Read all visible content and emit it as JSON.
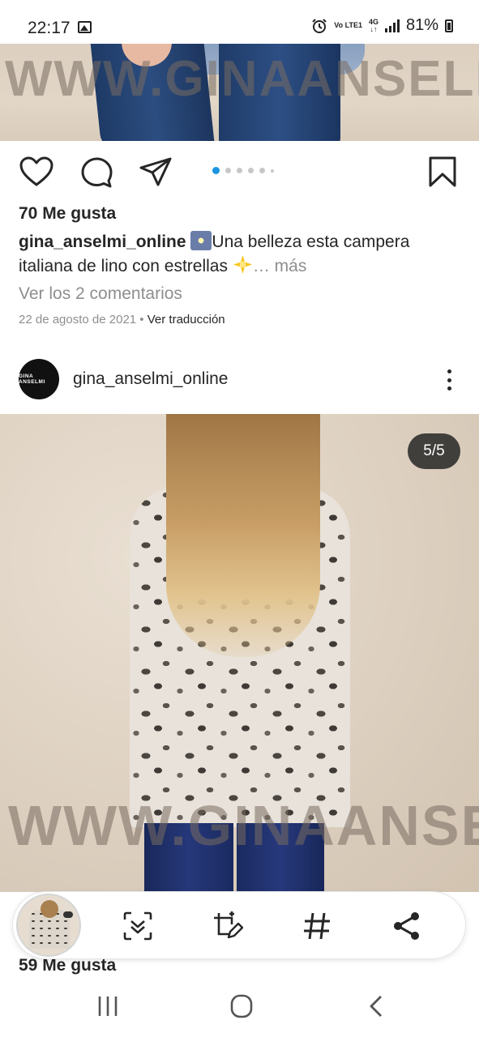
{
  "status_bar": {
    "time": "22:17",
    "volte": "Vo LTE1",
    "network": "4G",
    "battery": "81%"
  },
  "post1": {
    "watermark": "WWW.GINAANSELMI.COM",
    "likes": "70 Me gusta",
    "username": "gina_anselmi_online",
    "caption_line1": "Una belleza esta campera",
    "caption_line2": "italiana de lino con estrellas",
    "more": "… más",
    "view_comments": "Ver los 2 comentarios",
    "date": "22 de agosto de 2021",
    "separator": " • ",
    "translate": "Ver traducción",
    "carousel_total_dots": 6,
    "carousel_active_index": 0
  },
  "post2": {
    "avatar_text": "GINA ANSELMI",
    "username": "gina_anselmi_online",
    "counter": "5/5",
    "watermark": "WWW.GINAANSELMI.COM",
    "likes": "59 Me gusta"
  },
  "colors": {
    "accent_blue": "#1b95e0",
    "text": "#262626",
    "muted": "#8e8e8e"
  },
  "icons": {
    "post_actions": [
      "heart-icon",
      "comment-icon",
      "share-icon",
      "bookmark-icon"
    ],
    "toolbar": [
      "scan-text-icon",
      "crop-edit-icon",
      "hashtag-icon",
      "share-node-icon"
    ],
    "nav": [
      "recent-apps-icon",
      "home-icon",
      "back-icon"
    ]
  }
}
